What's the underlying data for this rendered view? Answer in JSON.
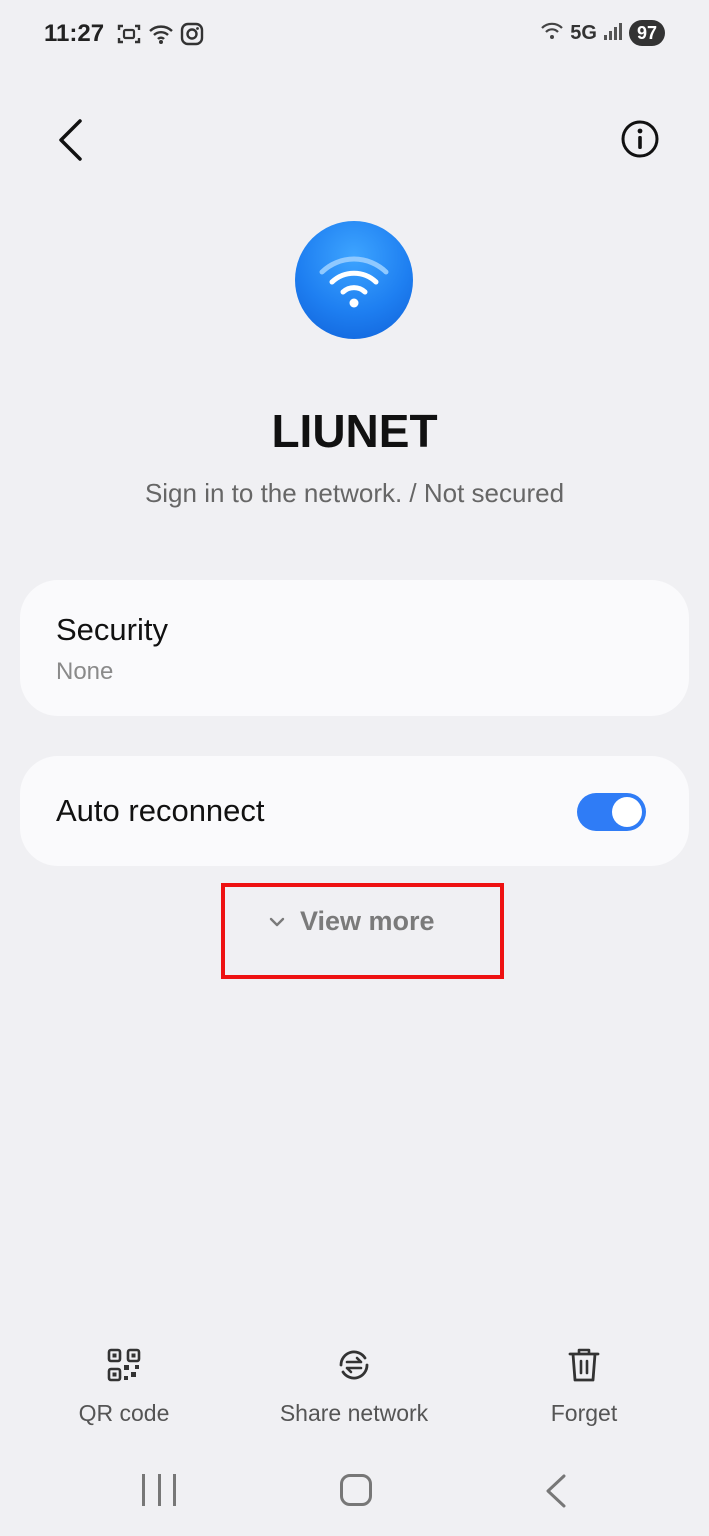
{
  "status_bar": {
    "time": "11:27",
    "network_type": "5G",
    "battery": "97"
  },
  "header": {
    "back_icon": "chevron-left-icon",
    "info_icon": "info-icon"
  },
  "network": {
    "name": "LIUNET",
    "status": "Sign in to the network. / Not secured",
    "icon": "wifi-icon",
    "accent_color": "#1e7ff1"
  },
  "security": {
    "label": "Security",
    "value": "None"
  },
  "auto_reconnect": {
    "label": "Auto reconnect",
    "enabled": true,
    "toggle_color": "#2f7cf6"
  },
  "view_more": {
    "label": "View more",
    "highlight_color": "#ee1111"
  },
  "actions": [
    {
      "label": "QR code",
      "icon": "qr-code-icon"
    },
    {
      "label": "Share network",
      "icon": "share-network-icon"
    },
    {
      "label": "Forget",
      "icon": "trash-icon"
    }
  ]
}
